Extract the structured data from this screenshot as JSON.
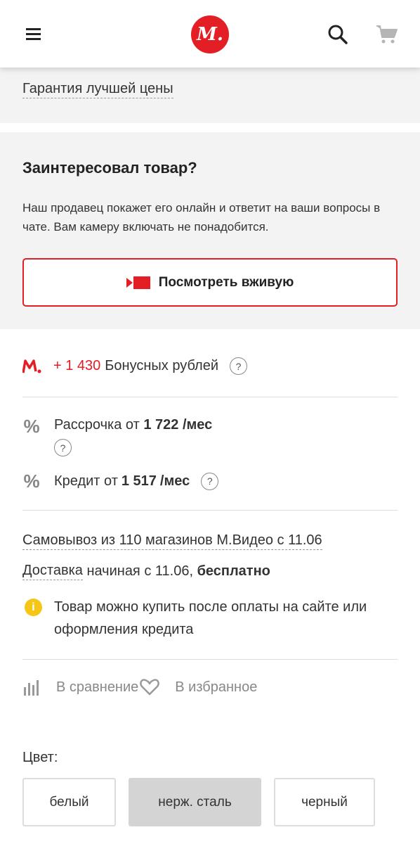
{
  "header": {
    "logo_text": "М.",
    "icons": [
      "menu-icon",
      "search-icon",
      "cart-icon"
    ],
    "brand_color": "#e31e24"
  },
  "guarantee": {
    "link": "Гарантия лучшей цены"
  },
  "interest": {
    "title": "Заинтересовал товар?",
    "description": "Наш продавец покажет его онлайн и ответит на ваши вопросы в чате. Вам камеру включать не понадобится.",
    "button_label": "Посмотреть вживую"
  },
  "bonus": {
    "amount": "+ 1 430",
    "label": "Бонусных рублей",
    "help": "?"
  },
  "installment": {
    "prefix": "Рассрочка от",
    "amount": "1 722",
    "currency": "",
    "suffix": "/мес",
    "help": "?"
  },
  "credit": {
    "prefix": "Кредит от",
    "amount": "1 517",
    "currency": "",
    "suffix": "/мес",
    "help": "?"
  },
  "delivery": {
    "pickup": "Самовывоз из 110 магазинов М.Видео с 11.06",
    "delivery_prefix": "Доставка",
    "delivery_text": " начиная с 11.06, ",
    "delivery_free": "бесплатно"
  },
  "info": {
    "icon": "i",
    "text": "Товар можно купить после оплаты на сайте или оформления кредита"
  },
  "actions": {
    "compare": "В сравнение",
    "favorite": "В избранное"
  },
  "colors": {
    "label": "Цвет:",
    "options": [
      "белый",
      "нерж. сталь",
      "черный"
    ],
    "selected": "нерж. сталь"
  }
}
